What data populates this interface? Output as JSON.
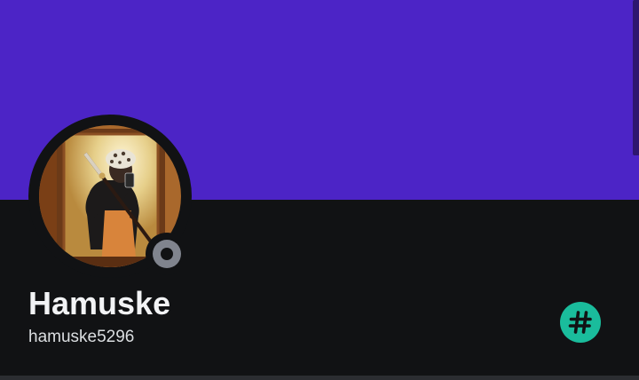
{
  "profile": {
    "display_name": "Hamuske",
    "username": "hamuske5296",
    "status": "offline"
  },
  "badge": {
    "icon": "hashtag-icon"
  },
  "colors": {
    "banner": "#4c24c6",
    "background": "#111214",
    "status_offline": "#80848e",
    "badge": "#1abc9c"
  }
}
